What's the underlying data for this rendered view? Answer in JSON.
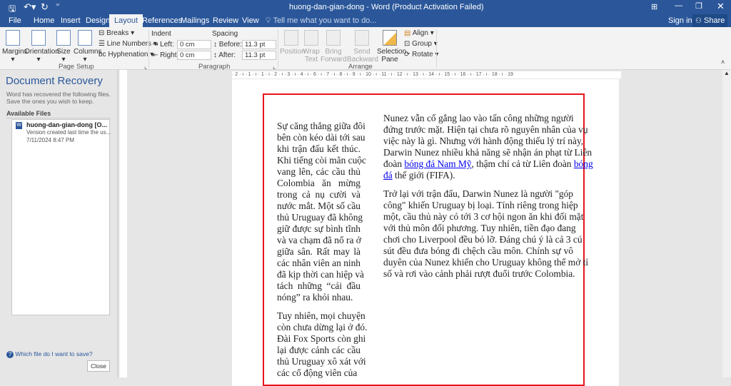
{
  "window": {
    "title": "huong-dan-gian-dong - Word (Product Activation Failed)",
    "qat_icons": [
      "save-icon",
      "undo-icon",
      "redo-icon",
      "customize-icon"
    ],
    "controls": [
      "ribbon-display-icon",
      "minimize-icon",
      "restore-icon",
      "close-icon"
    ]
  },
  "tabs": [
    "File",
    "Home",
    "Insert",
    "Design",
    "Layout",
    "References",
    "Mailings",
    "Review",
    "View"
  ],
  "active_tab": "Layout",
  "tell_me": "Tell me what you want to do...",
  "sign_in": "Sign in",
  "share": "Share",
  "ribbon": {
    "page_setup": {
      "label": "Page Setup",
      "margins": "Margins",
      "orientation": "Orientation",
      "size": "Size",
      "columns": "Columns",
      "breaks": "Breaks",
      "line_numbers": "Line Numbers",
      "hyphenation": "Hyphenation"
    },
    "paragraph": {
      "label": "Paragraph",
      "indent": "Indent",
      "left_label": "Left:",
      "left_value": "0 cm",
      "right_label": "Right:",
      "right_value": "0 cm",
      "spacing": "Spacing",
      "before_label": "Before:",
      "before_value": "11.3 pt",
      "after_label": "After:",
      "after_value": "11.3 pt"
    },
    "arrange": {
      "label": "Arrange",
      "position": "Position",
      "wrap_text": "Wrap Text",
      "bring_forward": "Bring Forward",
      "send_backward": "Send Backward",
      "selection_pane": "Selection Pane",
      "align": "Align",
      "group": "Group",
      "rotate": "Rotate"
    }
  },
  "ruler": "· 2 · ı · 1 · ı · 1 · ı · 2 · ı · 3 · ı · 4 · ı ·     6 · ı · 7 · ı · 8 · ı · 9 · ı · 10 · ı · 11 · ı · 12 · ı · 13 · ı · 14 · ı · 15 · ı · 16 · ı · 17 · ı · 18 · ı · 19",
  "recovery": {
    "title": "Document Recovery",
    "description": "Word has recovered the following files.  Save the ones you wish to keep.",
    "available": "Available Files",
    "file": {
      "name": "huong-dan-gian-dong  [O...",
      "desc": "Version created last time the us...",
      "date": "7/11/2024 8:47 PM"
    },
    "help": "Which file do I want to save?",
    "close": "Close"
  },
  "document": {
    "left_col": [
      [
        "Sự căng thẳng giữa đôi",
        "bên còn kéo dài tới sau",
        "khi trận đấu kết thúc.",
        "Khi tiếng còi mãn cuộc",
        "vang lên, các cầu thủ",
        "Colombia ăn mừng",
        "trong cả nụ cười và",
        "nước mắt. Một số cầu",
        "thủ Uruguay đã không",
        "giữ được sự bình tĩnh",
        "và va chạm đã nổ ra ở",
        "giữa sân. Rất may là",
        "các nhân viên an ninh",
        "đã kịp thời can hiệp và",
        "tách những “cái đầu",
        "nóng” ra khỏi nhau."
      ],
      [
        "Tuy nhiên, mọi chuyện",
        "còn chưa dừng lại ở đó.",
        "Đài Fox Sports còn ghi",
        "lại được cảnh các cầu",
        "thủ Uruguay xô xát với",
        "các cổ động viên của"
      ]
    ],
    "right_p1": {
      "l1": "Nunez vẫn cố gắng lao vào tấn công những người",
      "l2": "đứng trước mặt. Hiện tại chưa rõ nguyên nhân của vụ",
      "l3": "việc này là gì. Nhưng với hành động thiếu lý trí này,",
      "l4": "Darwin Nunez nhiều khả năng sẽ nhận án phạt từ Liên",
      "l5a": "đoàn ",
      "link1": "bóng đá Nam Mỹ",
      "l5b": ", thậm chí cả từ Liên đoàn ",
      "link2a": "bóng",
      "link2b": "đá",
      "l6": " thế giới (FIFA)."
    },
    "right_p2": [
      "Trở lại với trận đấu, Darwin Nunez là người \"góp",
      "công\" khiến Uruguay bị loại. Tính riêng trong hiệp",
      "một, cầu thủ này có tới 3 cơ hội ngon ăn khi đối mặt",
      "với thủ môn đối phương. Tuy nhiên, tiền đạo đang",
      "chơi cho Liverpool đều bỏ lỡ. Đáng chú ý là cả 3 cú",
      "sút đều đưa bóng đi chệch cầu môn. Chính sự vô",
      "duyên của Nunez khiến cho Uruguay không thể mở tỉ",
      "số và rơi vào cảnh phải rượt đuổi trước Colombia."
    ]
  },
  "colors": {
    "brand": "#2b579a",
    "highlight_box": "#e8141c",
    "link": "#0000ee"
  }
}
